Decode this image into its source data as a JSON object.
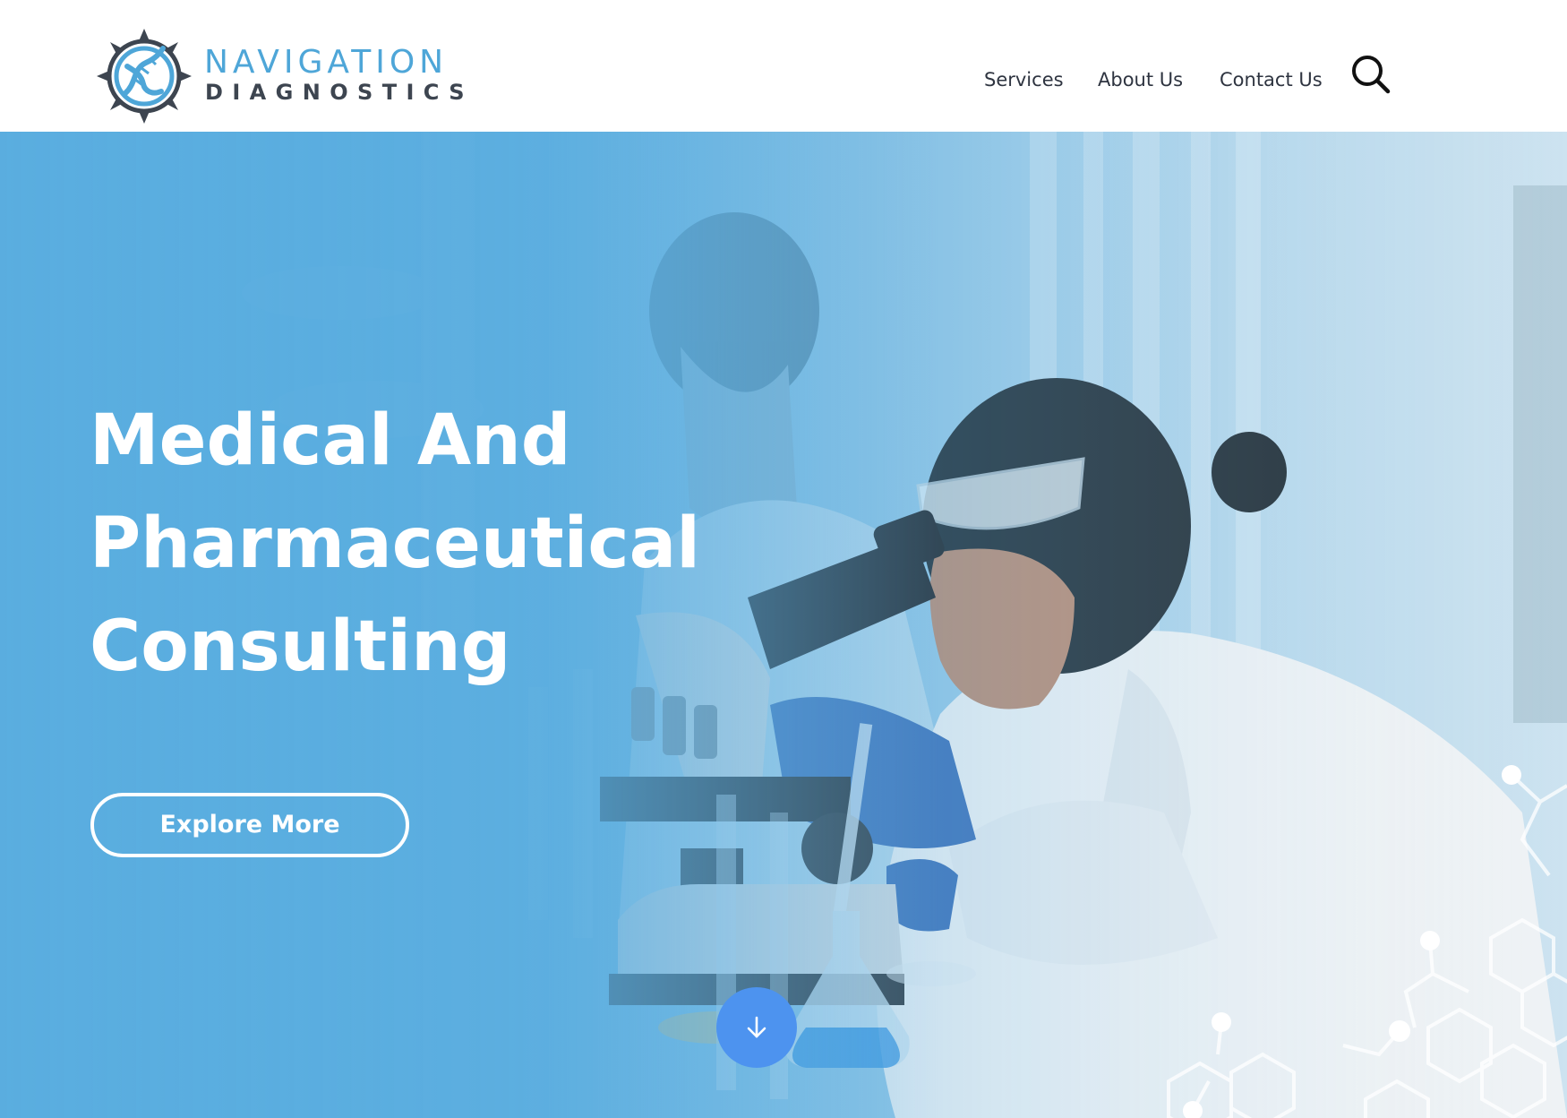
{
  "brand": {
    "name_line1": "NAVIGATION",
    "name_line2": "DIAGNOSTICS",
    "primary_color": "#4ea6d8",
    "dark_color": "#3d4550"
  },
  "nav": {
    "items": [
      {
        "label": "Services"
      },
      {
        "label": "About Us"
      },
      {
        "label": "Contact Us"
      }
    ],
    "search_icon": "search-icon"
  },
  "hero": {
    "title_lines": [
      "Medical And",
      "Pharmaceutical",
      "Consulting"
    ],
    "cta_label": "Explore More",
    "scroll_icon": "arrow-down-icon",
    "overlay_color": "#5aaddf",
    "scroll_button_color": "#4d93ef"
  }
}
